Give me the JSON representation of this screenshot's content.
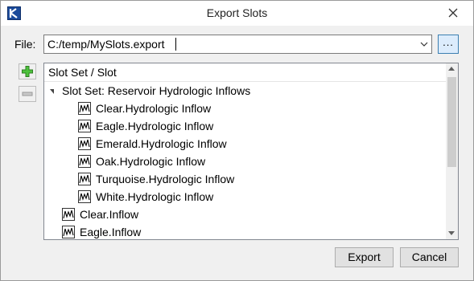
{
  "window": {
    "title": "Export Slots"
  },
  "file": {
    "label": "File:",
    "value": "C:/temp/MySlots.export",
    "browse_label": "..."
  },
  "tree": {
    "header": "Slot Set / Slot",
    "slot_set": {
      "label": "Slot Set: Reservoir Hydrologic Inflows",
      "expanded": true,
      "children": [
        "Clear.Hydrologic Inflow",
        "Eagle.Hydrologic Inflow",
        "Emerald.Hydrologic Inflow",
        "Oak.Hydrologic Inflow",
        "Turquoise.Hydrologic Inflow",
        "White.Hydrologic Inflow"
      ]
    },
    "slots": [
      "Clear.Inflow",
      "Eagle.Inflow"
    ]
  },
  "buttons": {
    "export": "Export",
    "cancel": "Cancel"
  },
  "icons": {
    "add": "plus-icon",
    "remove": "minus-icon",
    "slot": "series-slot-icon",
    "app": "riverware-icon",
    "close": "close-icon"
  },
  "colors": {
    "add_green": "#3aa82f",
    "browse_blue": "#dcecfc",
    "app_blue": "#1b4b9b"
  }
}
